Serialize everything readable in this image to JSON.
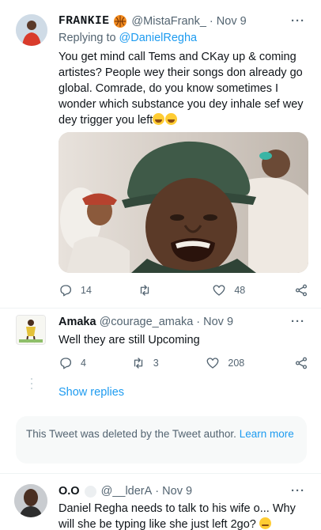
{
  "tweet1": {
    "display_name": "FRANKIE",
    "handle": "@MistaFrank_",
    "date": "· Nov 9",
    "replying_prefix": "Replying to",
    "replying_to": "@DanielRegha",
    "text": "You get mind call Tems and CKay up & coming artistes? People wey their songs don already go global. Comrade, do you know sometimes I wonder which substance you dey inhale sef wey dey trigger you left",
    "more": "···",
    "replies": "14",
    "retweets": "",
    "likes": "48"
  },
  "tweet2": {
    "display_name": "Amaka",
    "handle": "@courage_amaka",
    "date": "· Nov 9",
    "text": "Well they are still Upcoming",
    "more": "···",
    "replies": "4",
    "retweets": "3",
    "likes": "208"
  },
  "show_replies": "Show replies",
  "deleted": {
    "text": "This Tweet was deleted by the Tweet author.",
    "link": "Learn more"
  },
  "tweet3": {
    "display_name": "O.O",
    "handle": "@__lderA",
    "date": "· Nov 9",
    "text": "Daniel Regha needs to talk to his wife o... Why will she be typing like she just left 2go?",
    "more": "···"
  },
  "colors": {
    "accent": "#1d9bf0",
    "muted": "#536471",
    "text": "#0f1419"
  }
}
